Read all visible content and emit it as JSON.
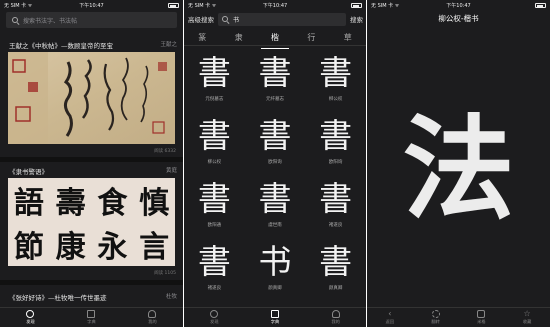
{
  "status": {
    "carrier": "无 SIM 卡 ᯤ",
    "time": "下午10:47"
  },
  "panel1": {
    "search_placeholder": "搜索书法字、书法帖",
    "cards": [
      {
        "title": "王献之《中秋帖》—数顾皇帝的至宝",
        "author": "王献之",
        "reads": "阅读 6332"
      },
      {
        "title": "《隶书警语》",
        "author": "黄庭",
        "reads": "阅读 1105"
      },
      {
        "title": "《张好好诗》—杜牧唯一传世墨迹",
        "author": "杜牧",
        "reads": ""
      }
    ],
    "clerical_chars": [
      "語",
      "壽",
      "食",
      "慎",
      "節",
      "康",
      "永",
      "言"
    ],
    "tabs": [
      {
        "label": "发现",
        "icon": "compass-icon",
        "active": true
      },
      {
        "label": "字典",
        "icon": "book-icon",
        "active": false
      },
      {
        "label": "我的",
        "icon": "person-icon",
        "active": false
      }
    ]
  },
  "panel2": {
    "advanced_label": "高级搜索",
    "search_value": "书",
    "search_button": "搜索",
    "style_tabs": [
      {
        "label": "篆",
        "active": false
      },
      {
        "label": "隶",
        "active": false
      },
      {
        "label": "楷",
        "active": true
      },
      {
        "label": "行",
        "active": false
      },
      {
        "label": "草",
        "active": false
      }
    ],
    "results": [
      {
        "char": "書",
        "name": "元倪墓志"
      },
      {
        "char": "書",
        "name": "元纤墓志"
      },
      {
        "char": "書",
        "name": "柳公权"
      },
      {
        "char": "書",
        "name": "柳公权"
      },
      {
        "char": "書",
        "name": "欧阳询"
      },
      {
        "char": "書",
        "name": "欧阳询"
      },
      {
        "char": "書",
        "name": "欧阳通"
      },
      {
        "char": "書",
        "name": "虞世南"
      },
      {
        "char": "書",
        "name": "褚遂良"
      },
      {
        "char": "書",
        "name": "褚遂良"
      },
      {
        "char": "书",
        "name": "颜真卿"
      },
      {
        "char": "書",
        "name": "颜真卿"
      }
    ],
    "tabs": [
      {
        "label": "发现",
        "icon": "compass-icon",
        "active": false
      },
      {
        "label": "字典",
        "icon": "book-icon",
        "active": true
      },
      {
        "label": "我的",
        "icon": "person-icon",
        "active": false
      }
    ]
  },
  "panel3": {
    "title": "柳公权-楷书",
    "character": "法",
    "tabs": [
      {
        "label": "返回",
        "icon": "back-icon"
      },
      {
        "label": "翻转",
        "icon": "flip-icon"
      },
      {
        "label": "米格",
        "icon": "grid-icon"
      },
      {
        "label": "收藏",
        "icon": "star-icon"
      }
    ]
  },
  "colors": {
    "background": "#1c1c1e",
    "search_bg": "#2e2e30",
    "text": "#f2f2f2",
    "muted": "#8a8a8e"
  }
}
